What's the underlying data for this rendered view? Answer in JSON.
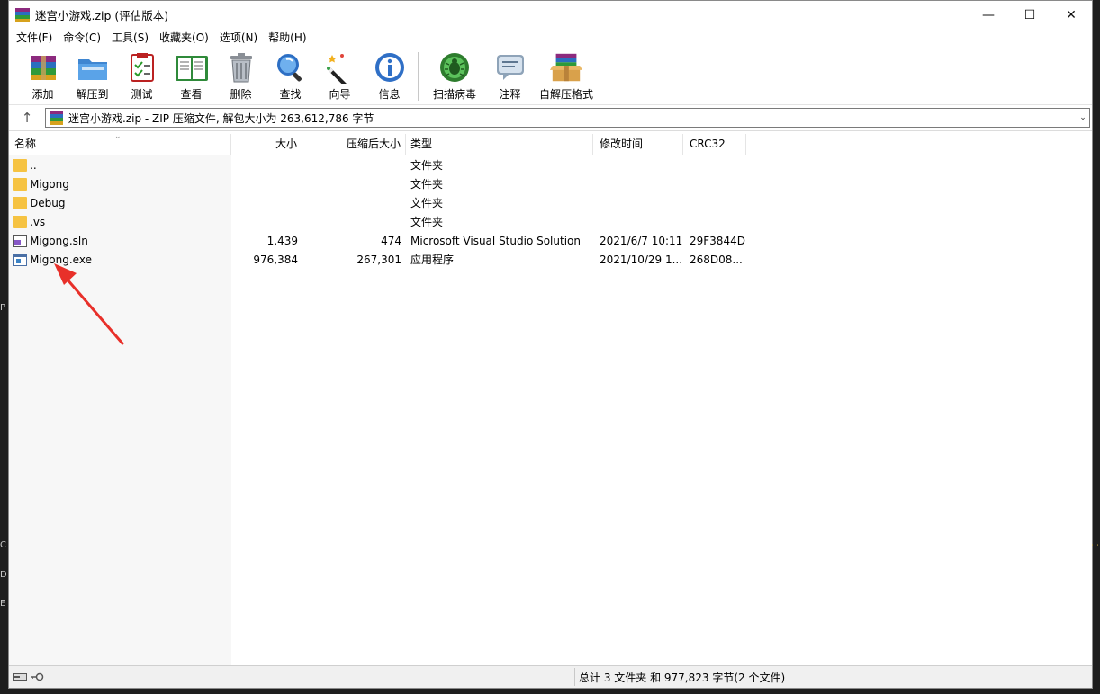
{
  "window": {
    "title": "迷宫小游戏.zip (评估版本)",
    "controls": {
      "minimize": "—",
      "maximize": "☐",
      "close": "✕"
    }
  },
  "menu": [
    "文件(F)",
    "命令(C)",
    "工具(S)",
    "收藏夹(O)",
    "选项(N)",
    "帮助(H)"
  ],
  "toolbar": [
    {
      "label": "添加",
      "icon": "add-archive-icon"
    },
    {
      "label": "解压到",
      "icon": "extract-to-icon"
    },
    {
      "label": "测试",
      "icon": "test-icon"
    },
    {
      "label": "查看",
      "icon": "view-icon"
    },
    {
      "label": "删除",
      "icon": "delete-icon"
    },
    {
      "label": "查找",
      "icon": "find-icon"
    },
    {
      "label": "向导",
      "icon": "wizard-icon"
    },
    {
      "label": "信息",
      "icon": "info-icon"
    },
    {
      "label": "扫描病毒",
      "icon": "virus-scan-icon"
    },
    {
      "label": "注释",
      "icon": "comment-icon"
    },
    {
      "label": "自解压格式",
      "icon": "sfx-icon"
    }
  ],
  "address": {
    "up": "↑",
    "text": "迷宫小游戏.zip - ZIP 压缩文件, 解包大小为 263,612,786 字节",
    "dropdown": "⌄"
  },
  "columns": {
    "name": "名称",
    "size": "大小",
    "packed": "压缩后大小",
    "type": "类型",
    "modified": "修改时间",
    "crc": "CRC32",
    "sort": "⌄"
  },
  "files": [
    {
      "name": "..",
      "size": "",
      "packed": "",
      "type": "文件夹",
      "modified": "",
      "crc": "",
      "icon": "folder-icon"
    },
    {
      "name": "Migong",
      "size": "",
      "packed": "",
      "type": "文件夹",
      "modified": "",
      "crc": "",
      "icon": "folder-icon"
    },
    {
      "name": "Debug",
      "size": "",
      "packed": "",
      "type": "文件夹",
      "modified": "",
      "crc": "",
      "icon": "folder-icon"
    },
    {
      "name": ".vs",
      "size": "",
      "packed": "",
      "type": "文件夹",
      "modified": "",
      "crc": "",
      "icon": "folder-icon"
    },
    {
      "name": "Migong.sln",
      "size": "1,439",
      "packed": "474",
      "type": "Microsoft Visual Studio Solution",
      "modified": "2021/6/7 10:11",
      "crc": "29F3844D",
      "icon": "vs-solution-icon"
    },
    {
      "name": "Migong.exe",
      "size": "976,384",
      "packed": "267,301",
      "type": "应用程序",
      "modified": "2021/10/29 1...",
      "crc": "268D08...",
      "icon": "exe-icon"
    }
  ],
  "status": {
    "text": "总计 3 文件夹 和 977,823 字节(2 个文件)"
  },
  "colors": {
    "folder": "#f6c342",
    "arrow": "#e8302a"
  }
}
